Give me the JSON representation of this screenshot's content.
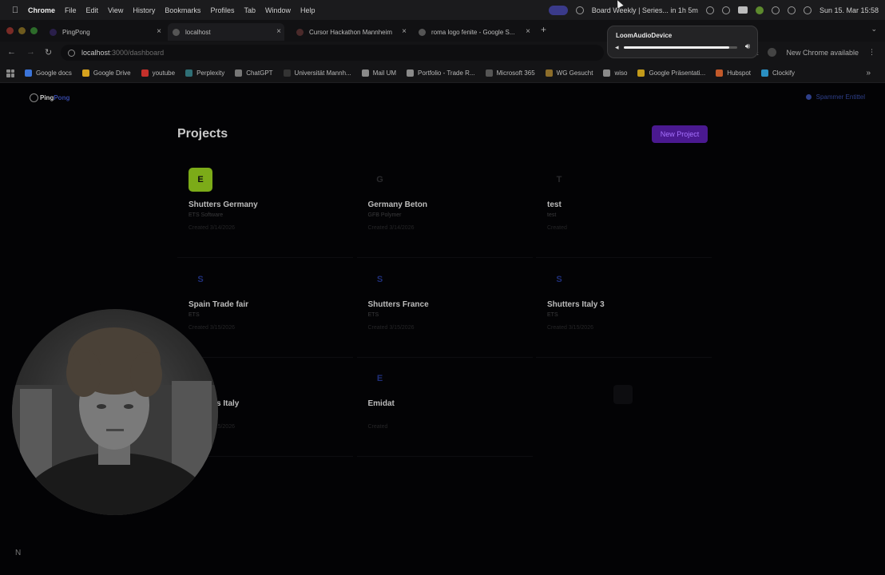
{
  "menubar": {
    "app": "Chrome",
    "items": [
      "File",
      "Edit",
      "View",
      "History",
      "Bookmarks",
      "Profiles",
      "Tab",
      "Window",
      "Help"
    ],
    "event": "Board Weekly | Series... in 1h 5m",
    "datetime": "Sun 15. Mar 15:58"
  },
  "tabs": [
    {
      "title": "PingPong"
    },
    {
      "title": "localhost"
    },
    {
      "title": "Cursor Hackathon Mannheim"
    },
    {
      "title": "roma logo fenite - Google S..."
    }
  ],
  "address": {
    "host": "localhost",
    "path": ":3000/dashboard",
    "update_label": "New Chrome available"
  },
  "bookmarks": [
    {
      "label": "Google docs",
      "color": "#3b74d9"
    },
    {
      "label": "Google Drive",
      "color": "#d6a21e"
    },
    {
      "label": "youtube",
      "color": "#c4302b"
    },
    {
      "label": "Perplexity",
      "color": "#2f6f76"
    },
    {
      "label": "ChatGPT",
      "color": "#777777"
    },
    {
      "label": "Universität Mannh...",
      "color": "#333333"
    },
    {
      "label": "Mail UM",
      "color": "#8a8a8a"
    },
    {
      "label": "Portfolio - Trade R...",
      "color": "#8a8a8a"
    },
    {
      "label": "Microsoft 365",
      "color": "#555555"
    },
    {
      "label": "WG Gesucht",
      "color": "#8c6d2a"
    },
    {
      "label": "wiso",
      "color": "#8a8a8a"
    },
    {
      "label": "Google Präsentati...",
      "color": "#c29a1a"
    },
    {
      "label": "Hubspot",
      "color": "#c2592a"
    },
    {
      "label": "Clockify",
      "color": "#2a8fc2"
    }
  ],
  "app": {
    "logo_ping": "Ping",
    "logo_pong": "Pong",
    "user_name": "Spammer Entittel",
    "page_title": "Projects",
    "new_project_label": "New Project"
  },
  "projects": [
    {
      "icon": "E",
      "name": "Shutters Germany",
      "sub": "ETS Software",
      "date": "Created 3/14/2026",
      "style": "lime"
    },
    {
      "icon": "G",
      "name": "Germany Beton",
      "sub": "GFB Polymer",
      "date": "Created 3/14/2026",
      "style": "dim"
    },
    {
      "icon": "T",
      "name": "test",
      "sub": "test",
      "date": "Created",
      "style": "dim"
    },
    {
      "icon": "S",
      "name": "Spain Trade fair",
      "sub": "ETS",
      "date": "Created 3/15/2026",
      "style": "blue"
    },
    {
      "icon": "S",
      "name": "Shutters France",
      "sub": "ETS",
      "date": "Created 3/15/2026",
      "style": "blue"
    },
    {
      "icon": "S",
      "name": "Shutters Italy 3",
      "sub": "ETS",
      "date": "Created 3/15/2026",
      "style": "blue"
    },
    {
      "icon": "S",
      "name": "Shutters Italy",
      "sub": "ETS",
      "date": "Created 3/15/2026",
      "style": "blue"
    },
    {
      "icon": "E",
      "name": "Emidat",
      "sub": "",
      "date": "Created",
      "style": "blue"
    }
  ],
  "sound_popup": {
    "device": "LoomAudioDevice",
    "volume_fraction": 0.93
  },
  "corner_badge": "N"
}
